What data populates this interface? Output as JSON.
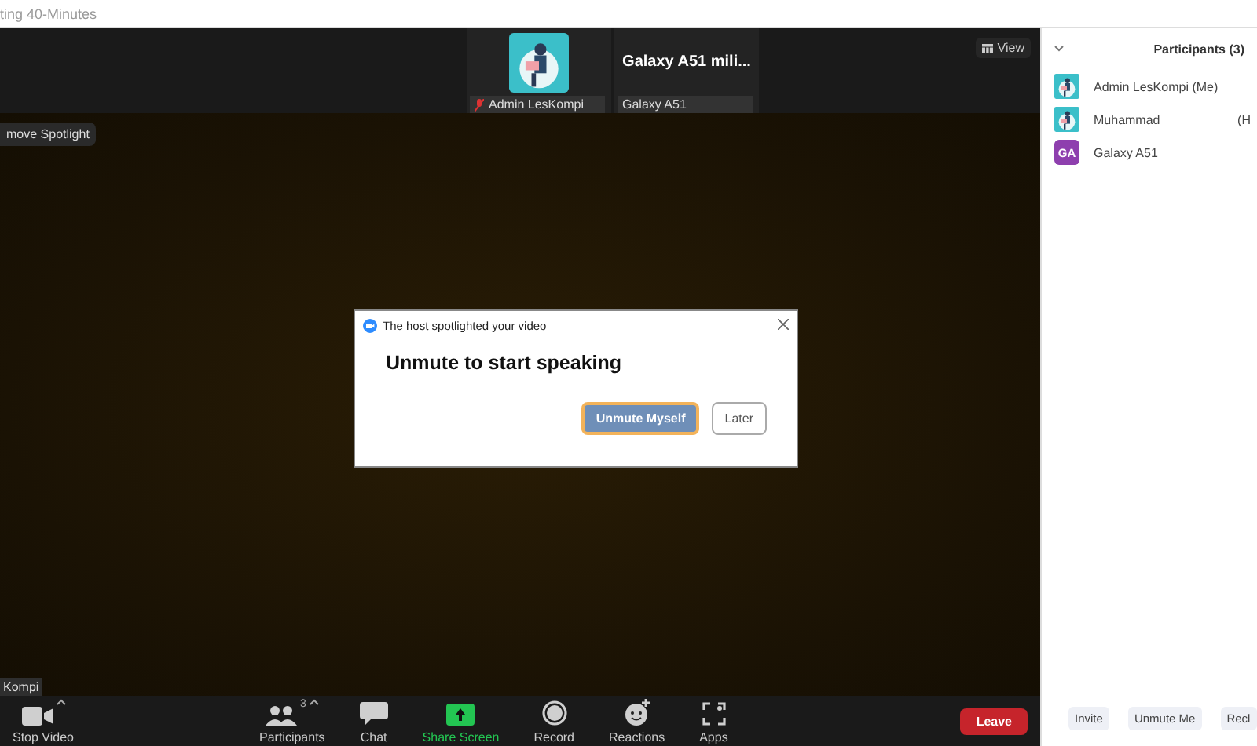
{
  "window": {
    "title": "ting 40-Minutes"
  },
  "thumbnails": [
    {
      "name": "Admin LesKompi",
      "kind": "picture",
      "muted": true
    },
    {
      "name": "Galaxy A51",
      "kind": "text",
      "display": "Galaxy A51 mili..."
    }
  ],
  "view_button": "View",
  "spotlight_button": "move Spotlight",
  "name_tag": "Kompi",
  "dialog": {
    "header": "The host spotlighted your video",
    "heading": "Unmute to start speaking",
    "buttons": [
      {
        "label": "Unmute Myself",
        "primary": true
      },
      {
        "label": "Later",
        "primary": false
      }
    ]
  },
  "toolbar": [
    {
      "kind": "video",
      "label": "Stop Video",
      "caret": true
    },
    {
      "kind": "participants",
      "label": "Participants",
      "badge": "3",
      "caret": true
    },
    {
      "kind": "chat",
      "label": "Chat",
      "caret": false
    },
    {
      "kind": "share",
      "label": "Share Screen",
      "caret": false
    },
    {
      "kind": "record",
      "label": "Record",
      "caret": false
    },
    {
      "kind": "reactions",
      "label": "Reactions",
      "caret": false
    },
    {
      "kind": "apps",
      "label": "Apps",
      "caret": false
    }
  ],
  "leave_button": "Leave",
  "panel": {
    "title": "Participants (3)",
    "participants": [
      {
        "name": "Admin LesKompi (Me)",
        "kind": "picture"
      },
      {
        "name": "Muhammad",
        "role": "(H",
        "kind": "picture"
      },
      {
        "name": "Galaxy A51",
        "kind": "initials",
        "initials": "GA"
      }
    ],
    "buttons": [
      "Invite",
      "Unmute Me",
      "Recl"
    ]
  }
}
